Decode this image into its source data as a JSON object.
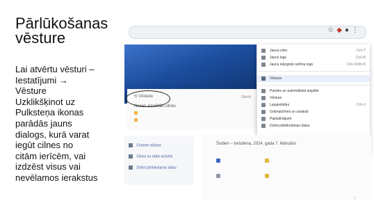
{
  "slide": {
    "title_line1": "Pārlūkošanas",
    "title_line2": "vēsture",
    "body_lines": [
      "Lai atvērtu vēsturi –",
      "Iestatījumi →",
      "Vēsture",
      "Uzklikšķinot uz",
      "Pulksteņa ikonas",
      "parādās jauns",
      "dialogs, kurā varat",
      "iegūt cilnes no",
      "citām ierīcēm, vai",
      "izdzēst visus vai",
      "nevēlamos ierakstus"
    ],
    "page_number": "7"
  },
  "screenshot": {
    "addr_placeholder": "",
    "addr_icons": [
      "star-icon",
      "extension-icon",
      "profile-icon",
      "menu-dots-icon"
    ],
    "history_panel": {
      "label": "Vēsture",
      "shortcut": "Ctrl+H",
      "row2": "Nesen aizvērtās cilnes",
      "row3": "",
      "row4": ""
    },
    "menu_items": [
      {
        "label": "Jauna cilne",
        "short": "Ctrl+T"
      },
      {
        "label": "Jauns logs",
        "short": "Ctrl+N"
      },
      {
        "label": "Jauns inkognito režīma logs",
        "short": "Ctrl+Shift+N"
      },
      {
        "label": "Vēsture",
        "short": ""
      },
      {
        "label": "Paroles un automātiskā aizpilde",
        "short": ""
      },
      {
        "label": "Vēsture",
        "short": ""
      },
      {
        "label": "Lejupielādes",
        "short": "Ctrl+J"
      },
      {
        "label": "Grāmatzīmes un saraksti",
        "short": ""
      },
      {
        "label": "Paplašinājumi",
        "short": ""
      },
      {
        "label": "Dzēst pārlūkošanas datus",
        "short": ""
      }
    ],
    "side_items": [
      "Chrome vēsture",
      "Cilnes no citām ierīcēm",
      "Dzēst pārlūkošanas datus"
    ],
    "sync_panel": {
      "title": "Šodien – trešdiena, 2024. gada 7. februāris",
      "rows": [
        {
          "time": "",
          "text": ""
        },
        {
          "time": "",
          "text": ""
        }
      ]
    }
  }
}
